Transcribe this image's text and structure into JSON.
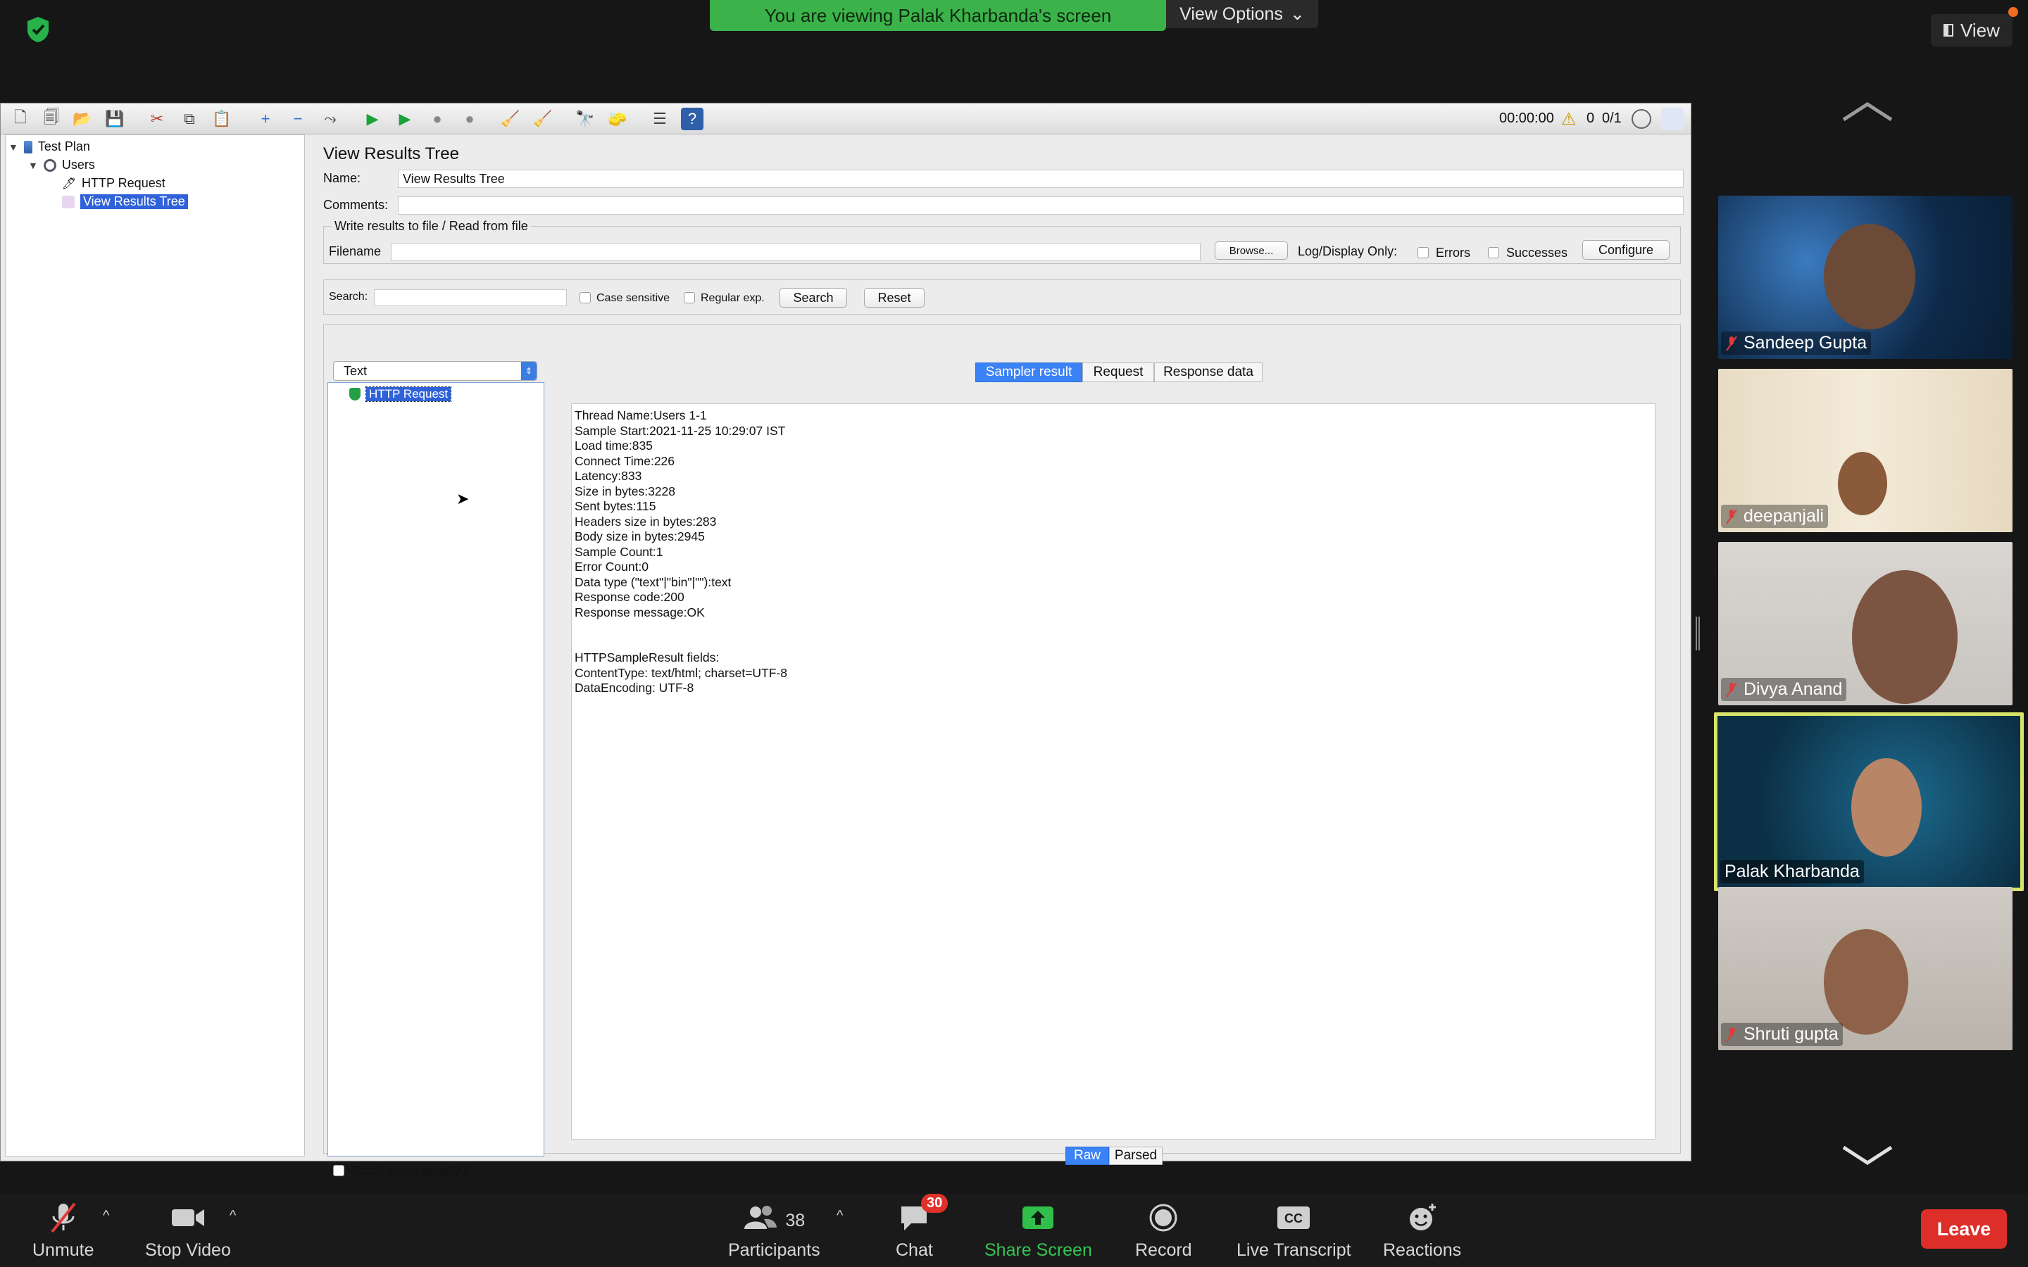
{
  "zoom": {
    "viewing_banner": "You are viewing Palak Kharbanda's screen",
    "view_options": "View Options",
    "view_button": "View",
    "colors": {
      "banner_green": "#3cb34a",
      "leave_red": "#dd2e2a",
      "accent_blue": "#3b82f6"
    }
  },
  "jmeter": {
    "toolbar": {
      "timer": "00:00:00",
      "error_count": "0",
      "threads": "0/1"
    },
    "tree": {
      "test_plan": "Test Plan",
      "users": "Users",
      "http_request": "HTTP Request",
      "view_results_tree": "View Results Tree"
    },
    "panel": {
      "title": "View Results Tree",
      "name_label": "Name:",
      "name_value": "View Results Tree",
      "comments_label": "Comments:",
      "write_results_legend": "Write results to file / Read from file",
      "filename_label": "Filename",
      "browse_button": "Browse...",
      "log_display_label": "Log/Display Only:",
      "errors_label": "Errors",
      "successes_label": "Successes",
      "configure_button": "Configure",
      "search_label": "Search:",
      "case_sensitive_label": "Case sensitive",
      "regular_exp_label": "Regular exp.",
      "search_button": "Search",
      "reset_button": "Reset",
      "renderer_select": "Text",
      "result_item": "HTTP Request",
      "tabs": [
        "Sampler result",
        "Request",
        "Response data"
      ],
      "active_tab": "Sampler result",
      "sampler_result_text": "Thread Name:Users 1-1\nSample Start:2021-11-25 10:29:07 IST\nLoad time:835\nConnect Time:226\nLatency:833\nSize in bytes:3228\nSent bytes:115\nHeaders size in bytes:283\nBody size in bytes:2945\nSample Count:1\nError Count:0\nData type (\"text\"|\"bin\"|\"\"):text\nResponse code:200\nResponse message:OK\n\n\nHTTPSampleResult fields:\nContentType: text/html; charset=UTF-8\nDataEncoding: UTF-8",
      "view_modes": [
        "Raw",
        "Parsed"
      ],
      "scroll_auto_label": "Scroll automatically?"
    }
  },
  "participants_gallery": [
    {
      "name": "Sandeep Gupta",
      "muted": true,
      "highlighted": false
    },
    {
      "name": "deepanjali",
      "muted": true,
      "highlighted": false
    },
    {
      "name": "Divya Anand",
      "muted": true,
      "highlighted": false
    },
    {
      "name": "Palak Kharbanda",
      "muted": false,
      "highlighted": true
    },
    {
      "name": "Shruti gupta",
      "muted": true,
      "highlighted": false
    }
  ],
  "bottom_bar": {
    "unmute": "Unmute",
    "stop_video": "Stop Video",
    "participants": "Participants",
    "participants_count": "38",
    "chat": "Chat",
    "chat_badge": "30",
    "share_screen": "Share Screen",
    "record": "Record",
    "live_transcript": "Live Transcript",
    "cc": "CC",
    "reactions": "Reactions",
    "leave": "Leave"
  }
}
